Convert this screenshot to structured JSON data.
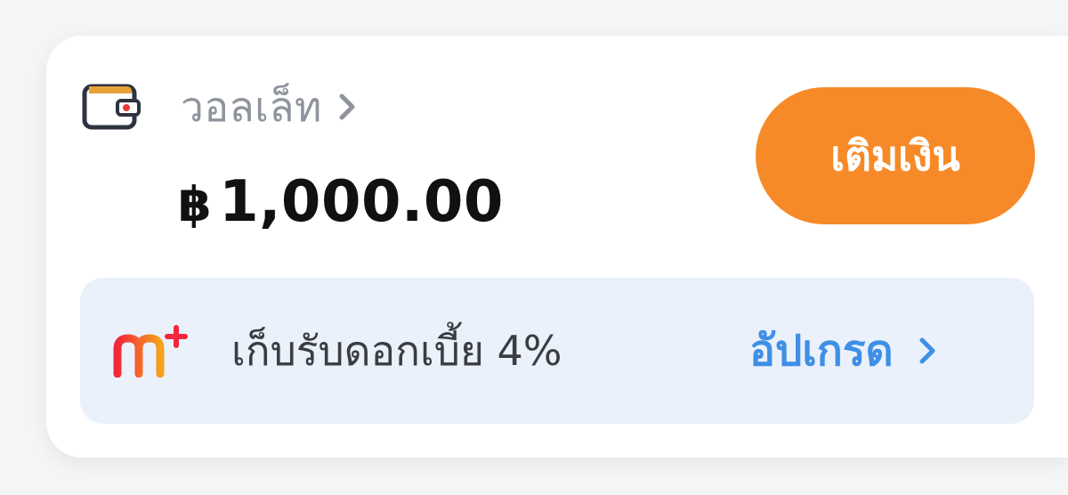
{
  "wallet": {
    "icon": "wallet-icon",
    "label": "วอลเล็ท",
    "currency_symbol": "฿",
    "balance": "1,000.00"
  },
  "topup": {
    "label": "เติมเงิน",
    "color": "#f78a28"
  },
  "promo": {
    "logo": "m-plus-logo",
    "text": "เก็บรับดอกเบี้ย 4%",
    "action_label": "อัปเกรด",
    "action_color": "#3f8fe6",
    "background": "#eaf1fb"
  }
}
